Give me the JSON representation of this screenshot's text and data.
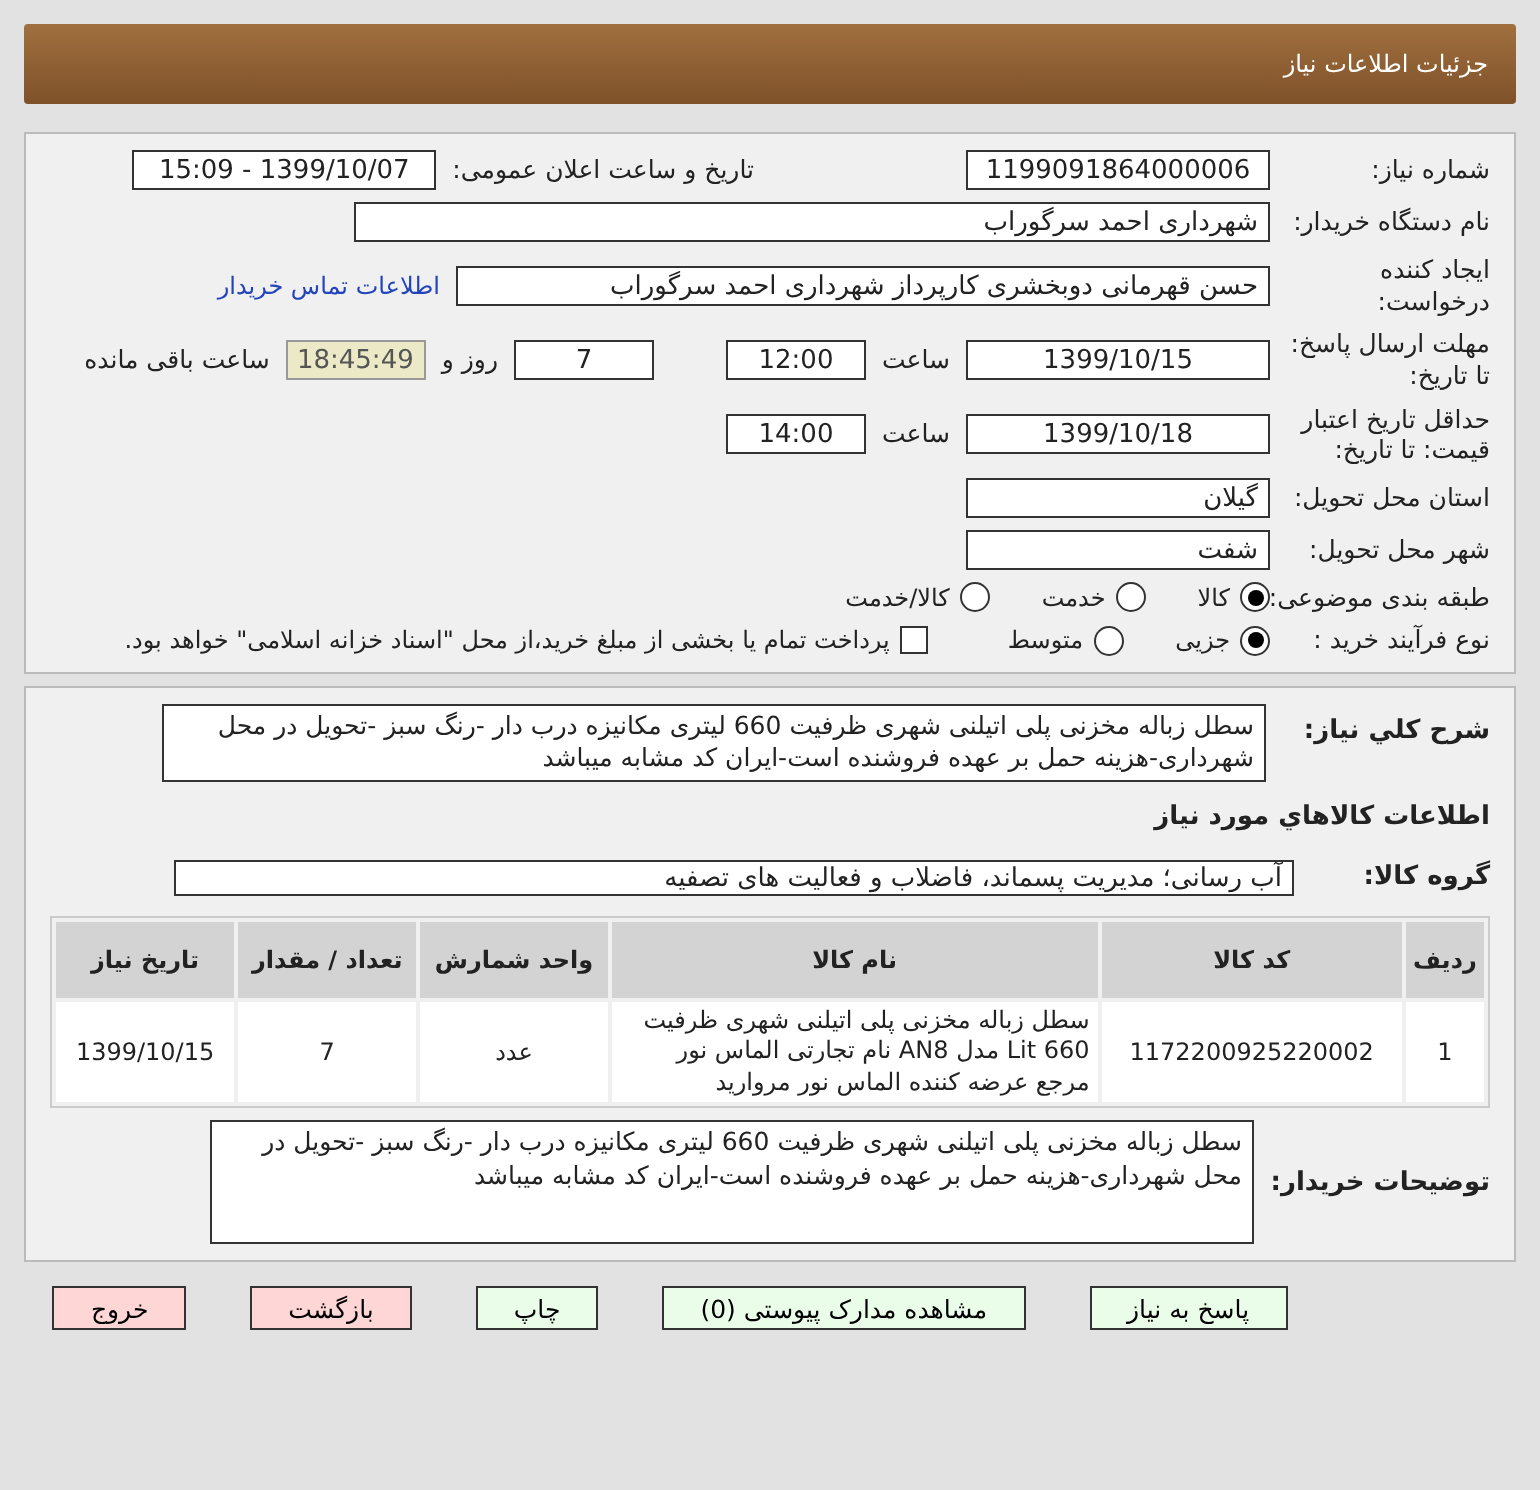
{
  "header": {
    "title": "جزئیات اطلاعات نیاز"
  },
  "details": {
    "need_number": {
      "label": "شماره نیاز:",
      "value": "1199091864000006"
    },
    "announce": {
      "label": "تاریخ و ساعت اعلان عمومی:",
      "value": "1399/10/07 - 15:09"
    },
    "buyer_org": {
      "label": "نام دستگاه خریدار:",
      "value": "شهرداری احمد سرگوراب"
    },
    "creator": {
      "label": "ایجاد کننده درخواست:",
      "value": "حسن قهرمانی دوبخشری کارپرداز شهرداری احمد سرگوراب",
      "link": "اطلاعات تماس خریدار"
    },
    "deadline": {
      "label": "مهلت ارسال پاسخ: تا تاریخ:",
      "date": "1399/10/15",
      "time_label": "ساعت",
      "time": "12:00",
      "days": "7",
      "days_label": "روز و",
      "remaining": "18:45:49",
      "remaining_label": "ساعت باقی مانده"
    },
    "validity": {
      "label": "حداقل تاریخ اعتبار قیمت: تا تاریخ:",
      "date": "1399/10/18",
      "time_label": "ساعت",
      "time": "14:00"
    },
    "province": {
      "label": "استان محل تحویل:",
      "value": "گیلان"
    },
    "city": {
      "label": "شهر محل تحویل:",
      "value": "شفت"
    },
    "category": {
      "label": "طبقه بندی موضوعی:",
      "options": [
        {
          "label": "کالا",
          "selected": true
        },
        {
          "label": "خدمت",
          "selected": false
        },
        {
          "label": "کالا/خدمت",
          "selected": false
        }
      ]
    },
    "process": {
      "label": "نوع فرآیند خرید :",
      "options": [
        {
          "label": "جزیی",
          "selected": true
        },
        {
          "label": "متوسط",
          "selected": false
        }
      ],
      "treasury": {
        "label": "پرداخت تمام یا بخشی از مبلغ خرید،از محل \"اسناد خزانه اسلامی\" خواهد بود.",
        "checked": false
      }
    }
  },
  "need": {
    "description_label": "شرح كلي نياز:",
    "description": "سطل زباله مخزنی پلی اتیلنی شهری ظرفیت 660 لیتری مکانیزه درب دار -رنگ سبز -تحویل در محل شهرداری-هزینه حمل بر عهده فروشنده است-ایران کد مشابه میباشد",
    "goods_heading": "اطلاعات كالاهاي مورد نياز",
    "group_label": "گروه کالا:",
    "group": "آب رسانی؛ مدیریت پسماند، فاضلاب و فعالیت های تصفیه",
    "table": {
      "columns": [
        "ردیف",
        "کد کالا",
        "نام کالا",
        "واحد شمارش",
        "تعداد / مقدار",
        "تاریخ نیاز"
      ],
      "rows": [
        [
          "1",
          "1172200925220002",
          "سطل زباله مخزنی پلی اتیلنی شهری ظرفیت Lit 660 مدل AN8 نام تجارتی الماس نور مرجع عرضه کننده الماس نور مروارید",
          "عدد",
          "7",
          "1399/10/15"
        ]
      ]
    },
    "buyer_notes_label": "توضیحات خریدار:",
    "buyer_notes": "سطل زباله مخزنی پلی اتیلنی شهری ظرفیت 660 لیتری مکانیزه درب دار -رنگ سبز -تحویل در محل شهرداری-هزینه حمل بر عهده فروشنده است-ایران کد مشابه میباشد"
  },
  "buttons": [
    {
      "label": "پاسخ به نیاز",
      "kind": "primary"
    },
    {
      "label": "مشاهده مدارک پیوستی (0)",
      "kind": "primary"
    },
    {
      "label": "چاپ",
      "kind": "primary"
    },
    {
      "label": "بازگشت",
      "kind": "danger"
    },
    {
      "label": "خروج",
      "kind": "danger"
    }
  ]
}
